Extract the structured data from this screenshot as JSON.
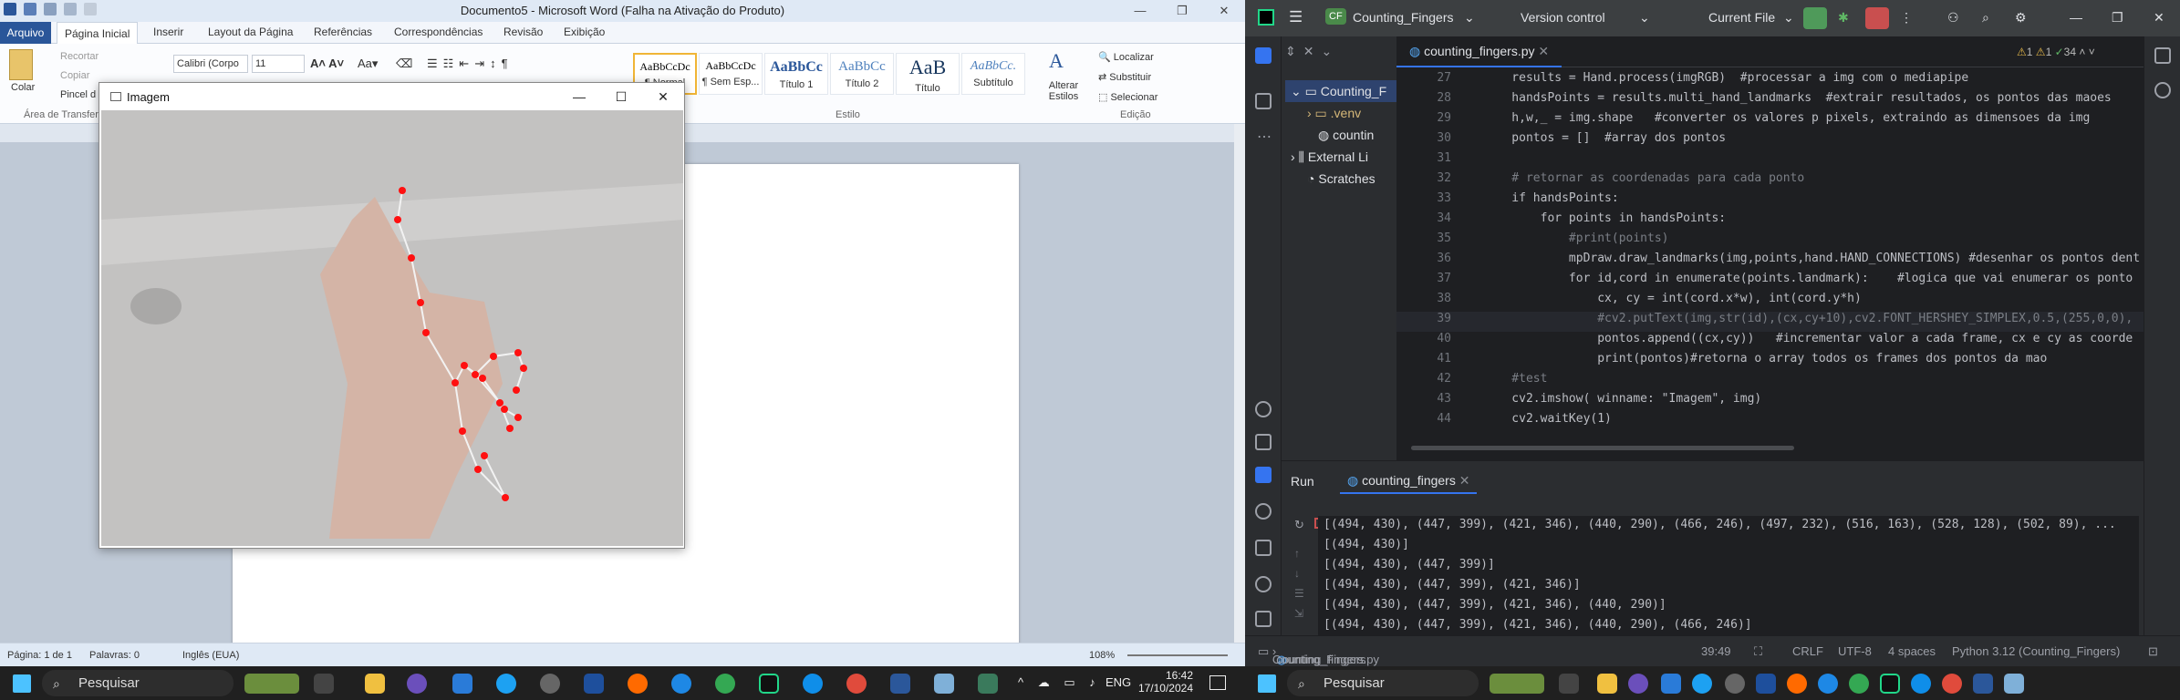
{
  "word": {
    "title": "Documento5 - Microsoft Word (Falha na Ativação do Produto)",
    "tabs": [
      "Arquivo",
      "Página Inicial",
      "Inserir",
      "Layout da Página",
      "Referências",
      "Correspondências",
      "Revisão",
      "Exibição"
    ],
    "clipboard": {
      "paste": "Colar",
      "cut": "Recortar",
      "copy": "Copiar",
      "format_painter": "Pincel d",
      "group": "Área de Transfer"
    },
    "font": {
      "name": "Calibri (Corpo",
      "size": "11"
    },
    "styles": [
      {
        "preview": "AaBbCcDc",
        "name": "¶ Normal"
      },
      {
        "preview": "AaBbCcDc",
        "name": "¶ Sem Esp..."
      },
      {
        "preview": "AaBbCc",
        "name": "Título 1"
      },
      {
        "preview": "AaBbCc",
        "name": "Título 2"
      },
      {
        "preview": "AaB",
        "name": "Título"
      },
      {
        "preview": "AaBbCc.",
        "name": "Subtítulo"
      }
    ],
    "styles_group": "Estilo",
    "change_styles": "Alterar Estilos",
    "editing": {
      "find": "Localizar",
      "replace": "Substituir",
      "select": "Selecionar",
      "group": "Edição"
    },
    "status": {
      "page": "Página: 1 de 1",
      "words": "Palavras: 0",
      "language": "Inglês (EUA)",
      "zoom": "108%"
    }
  },
  "cv_window": {
    "title": "Imagem"
  },
  "taskbar_left": {
    "search": "Pesquisar",
    "lang": "ENG",
    "time": "16:42",
    "date": "17/10/2024"
  },
  "taskbar_right": {
    "search": "Pesquisar"
  },
  "pycharm": {
    "project_badge": "CF",
    "project": "Counting_Fingers",
    "vcs": "Version control",
    "run_config": "Current File",
    "tree": [
      ".venv",
      "Counting_F",
      "countin",
      "External Li",
      "Scratches"
    ],
    "file_tab": "counting_fingers.py",
    "inspections": {
      "warn": "1",
      "weak": "1",
      "ok": "34"
    },
    "code": [
      {
        "n": "27",
        "t": "    results = Hand.process(imgRGB)  #processar a img com o mediapipe"
      },
      {
        "n": "28",
        "t": "    handsPoints = results.multi_hand_landmarks  #extrair resultados, os pontos das maoes"
      },
      {
        "n": "29",
        "t": "    h,w,_ = img.shape   #converter os valores p pixels, extraindo as dimensoes da img"
      },
      {
        "n": "30",
        "t": "    pontos = []  #array dos pontos"
      },
      {
        "n": "31",
        "t": ""
      },
      {
        "n": "32",
        "t": "    # retornar as coordenadas para cada ponto"
      },
      {
        "n": "33",
        "t": "    if handsPoints:"
      },
      {
        "n": "34",
        "t": "        for points in handsPoints:"
      },
      {
        "n": "35",
        "t": "            #print(points)"
      },
      {
        "n": "36",
        "t": "            mpDraw.draw_landmarks(img,points,hand.HAND_CONNECTIONS) #desenhar os pontos dent"
      },
      {
        "n": "37",
        "t": "            for id,cord in enumerate(points.landmark):    #logica que vai enumerar os ponto"
      },
      {
        "n": "38",
        "t": "                cx, cy = int(cord.x*w), int(cord.y*h)"
      },
      {
        "n": "39",
        "t": "                #cv2.putText(img,str(id),(cx,cy+10),cv2.FONT_HERSHEY_SIMPLEX,0.5,(255,0,0),"
      },
      {
        "n": "40",
        "t": "                pontos.append((cx,cy))   #incrementar valor a cada frame, cx e cy as coorde"
      },
      {
        "n": "41",
        "t": "                print(pontos)#retorna o array todos os frames dos pontos da mao"
      },
      {
        "n": "42",
        "t": "    #test"
      },
      {
        "n": "43",
        "t": "    cv2.imshow( winname: \"Imagem\", img)"
      },
      {
        "n": "44",
        "t": "    cv2.waitKey(1)"
      }
    ],
    "run_label": "Run",
    "run_tab": "counting_fingers",
    "console": [
      "[(494, 430), (447, 399), (421, 346), (440, 290), (466, 246), (497, 232), (516, 163), (528, 128), (502, 89), ...",
      "[(494, 430)]",
      "[(494, 430), (447, 399)]",
      "[(494, 430), (447, 399), (421, 346)]",
      "[(494, 430), (447, 399), (421, 346), (440, 290)]",
      "[(494, 430), (447, 399), (421, 346), (440, 290), (466, 246)]"
    ],
    "breadcrumb": [
      "Counting_Fingers",
      "counting_fingers.py"
    ],
    "status": {
      "pos": "39:49",
      "eol": "CRLF",
      "enc": "UTF-8",
      "indent": "4 spaces",
      "interp": "Python 3.12 (Counting_Fingers)"
    }
  }
}
